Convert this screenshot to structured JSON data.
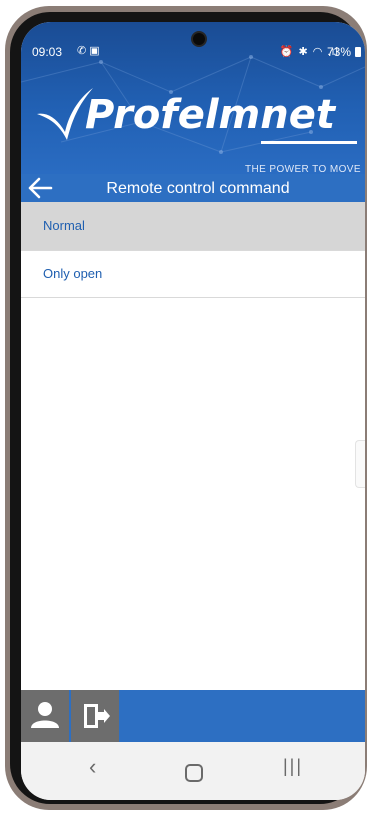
{
  "status_bar": {
    "time": "09:03",
    "left_icons": "✆ ▣",
    "right_icons": "⏰ ✱ ◠ .ıl",
    "battery": "73%"
  },
  "brand": {
    "name": "Profelmnet",
    "tagline": "THE POWER TO MOVE"
  },
  "title_bar": {
    "title": "Remote control command"
  },
  "options": [
    {
      "label": "Normal",
      "selected": true
    },
    {
      "label": "Only open",
      "selected": false
    }
  ],
  "colors": {
    "primary": "#2d6fc2",
    "header_dark": "#1a4c94",
    "selected_row": "#d6d6d6",
    "option_text": "#1f5fb0",
    "toolbar_button": "#6d6d6d"
  },
  "icons": {
    "back": "arrow-left-icon",
    "user": "user-icon",
    "logout": "exit-door-icon"
  },
  "nav_bar": {
    "back_glyph": "‹",
    "recent_glyph": "|||"
  }
}
